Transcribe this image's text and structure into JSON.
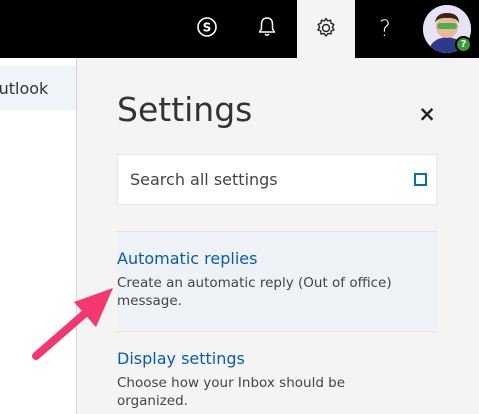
{
  "header": {
    "skype_icon": "skype-icon",
    "bell_icon": "bell-icon",
    "gear_icon": "gear-icon",
    "help_glyph": "?",
    "avatar_status": "?"
  },
  "sidebar": {
    "items": [
      {
        "label": "Outlook"
      }
    ]
  },
  "settings": {
    "title": "Settings",
    "close_glyph": "×",
    "search": {
      "placeholder": "Search all settings"
    },
    "items": [
      {
        "title": "Automatic replies",
        "description": "Create an automatic reply (Out of office) message."
      },
      {
        "title": "Display settings",
        "description": "Choose how your Inbox should be organized."
      }
    ]
  },
  "colors": {
    "accent": "#0a5bab",
    "topbar": "#000000",
    "panel": "#f4f4f4",
    "arrow": "#f2386f"
  }
}
